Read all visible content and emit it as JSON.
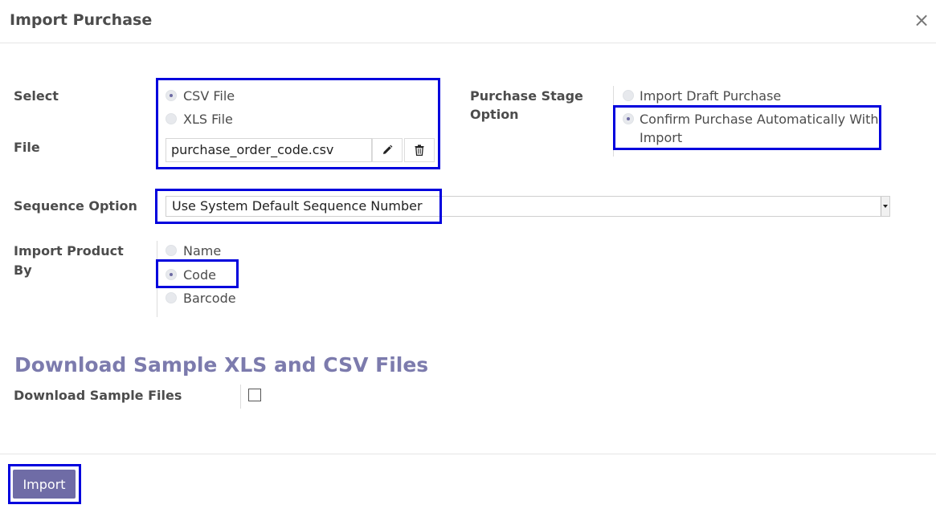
{
  "dialog": {
    "title": "Import Purchase",
    "close_glyph": "×"
  },
  "form": {
    "select_label": "Select",
    "file_label": "File",
    "file_types": [
      {
        "label": "CSV File",
        "checked": true
      },
      {
        "label": "XLS File",
        "checked": false
      }
    ],
    "file_name": "purchase_order_code.csv",
    "stage_label_line1": "Purchase Stage",
    "stage_label_line2": "Option",
    "stage_options": [
      {
        "label": "Import Draft Purchase",
        "checked": false
      },
      {
        "label_line1": "Confirm Purchase Automatically With",
        "label_line2": "Import",
        "checked": true
      }
    ],
    "sequence_label": "Sequence Option",
    "sequence_value": "Use System Default Sequence Number",
    "product_label_line1": "Import Product",
    "product_label_line2": "By",
    "product_options": [
      {
        "label": "Name",
        "checked": false
      },
      {
        "label": "Code",
        "checked": true
      },
      {
        "label": "Barcode",
        "checked": false
      }
    ]
  },
  "download": {
    "section_title": "Download Sample XLS and CSV Files",
    "label": "Download Sample Files",
    "checked": false
  },
  "footer": {
    "import_label": "Import"
  },
  "colors": {
    "highlight": "#0000dd",
    "accent": "#6f6ca6",
    "section_title": "#7c7bad"
  },
  "icons": [
    "close-icon",
    "pencil-icon",
    "trash-icon",
    "chevron-down-icon"
  ]
}
